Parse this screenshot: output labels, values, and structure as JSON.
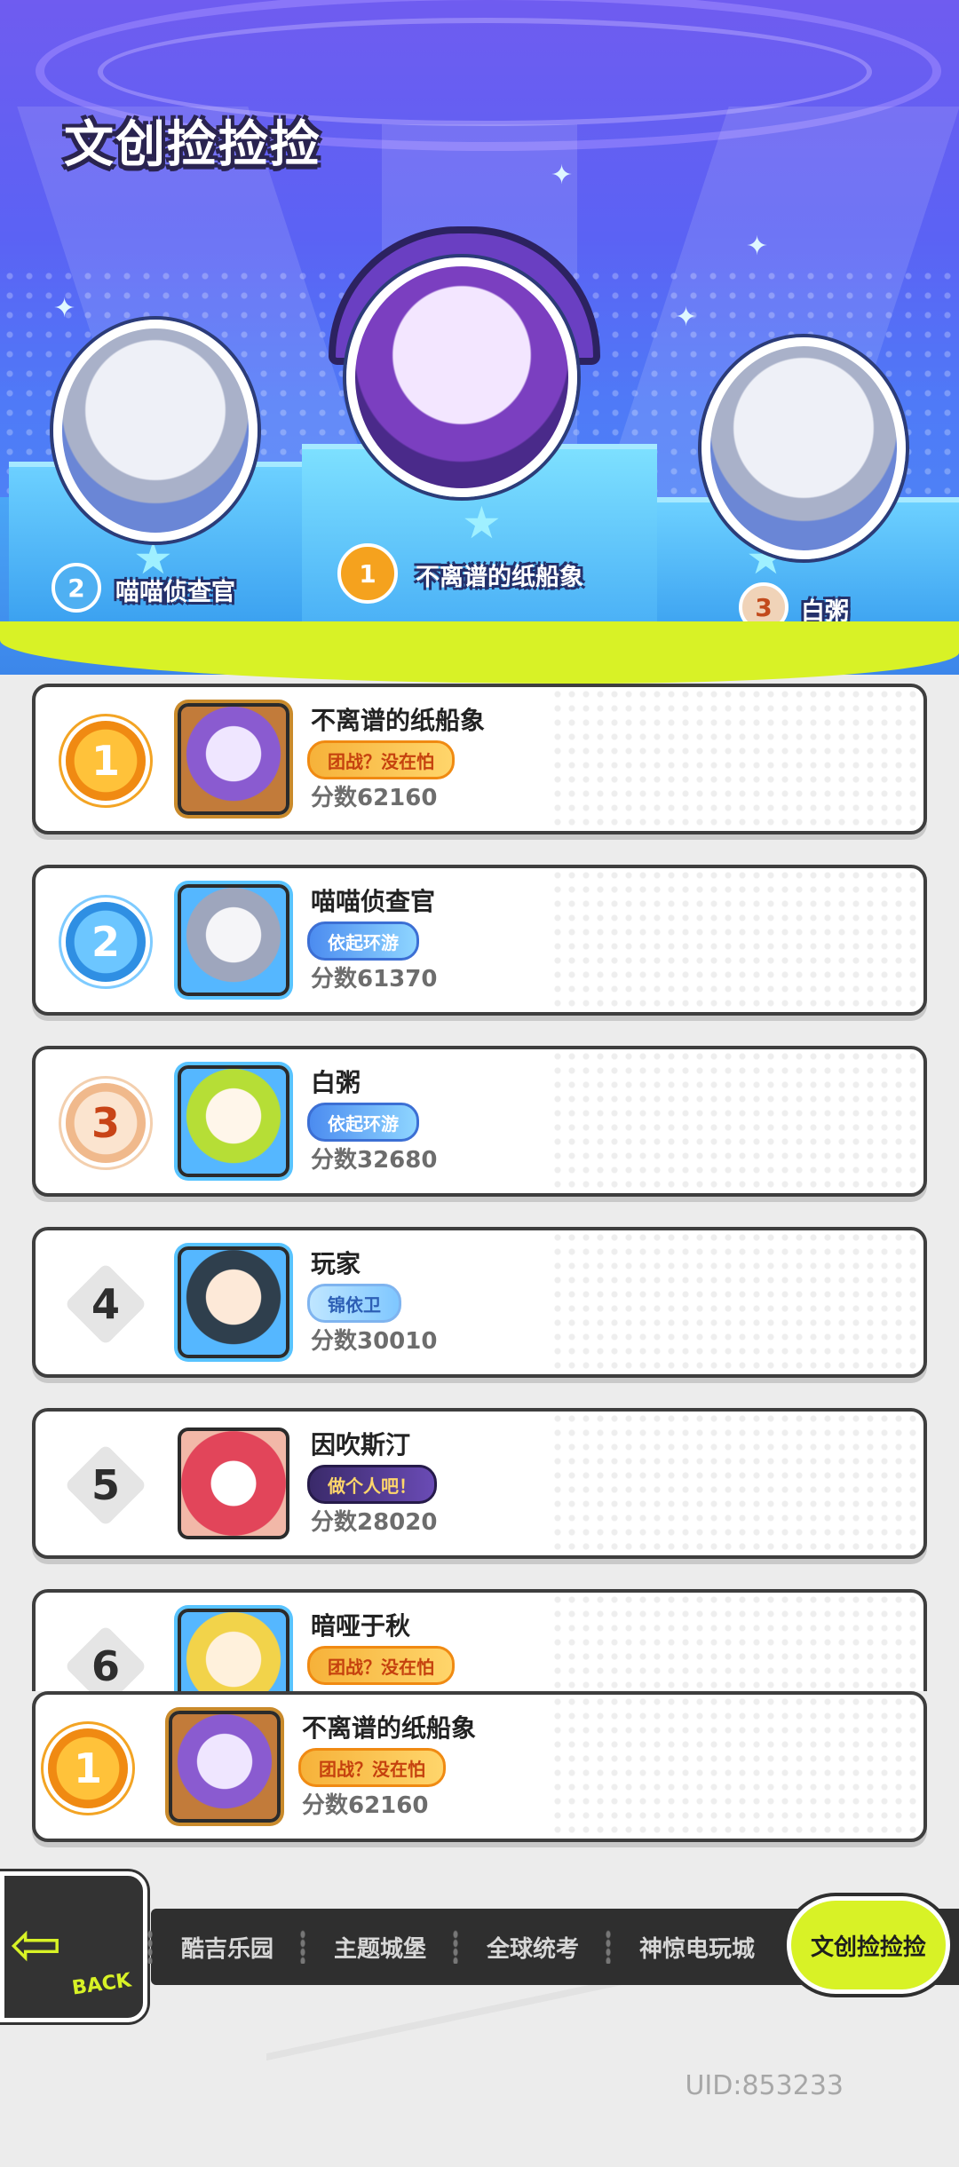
{
  "title": "文创捡捡捡",
  "podium": [
    {
      "rank": "2",
      "name": "喵喵侦查官"
    },
    {
      "rank": "1",
      "name": "不离谱的纸船象"
    },
    {
      "rank": "3",
      "name": "白粥"
    }
  ],
  "list": [
    {
      "rank": "1",
      "name": "不离谱的纸船象",
      "badge": "团战？没在怕",
      "score": "分数62160"
    },
    {
      "rank": "2",
      "name": "喵喵侦查官",
      "badge": "依起环游",
      "score": "分数61370"
    },
    {
      "rank": "3",
      "name": "白粥",
      "badge": "依起环游",
      "score": "分数32680"
    },
    {
      "rank": "4",
      "name": "玩家",
      "badge": "锦依卫",
      "score": "分数30010"
    },
    {
      "rank": "5",
      "name": "因吹斯汀",
      "badge": "做个人吧！",
      "score": "分数28020"
    },
    {
      "rank": "6",
      "name": "暗哑于秋",
      "badge": "团战？没在怕",
      "score": ""
    }
  ],
  "self": {
    "rank": "1",
    "name": "不离谱的纸船象",
    "badge": "团战？没在怕",
    "score": "分数62160"
  },
  "nav": {
    "back_label": "BACK",
    "tabs": [
      "酷吉乐园",
      "主题城堡",
      "全球统考",
      "神惊电玩城",
      "文创捡捡捡"
    ],
    "active_tab": "文创捡捡捡"
  },
  "uid": "UID:853233",
  "colors": {
    "accent": "#d8f226",
    "hero_bg": "#5b62f4",
    "gold": "#f5a21e"
  }
}
